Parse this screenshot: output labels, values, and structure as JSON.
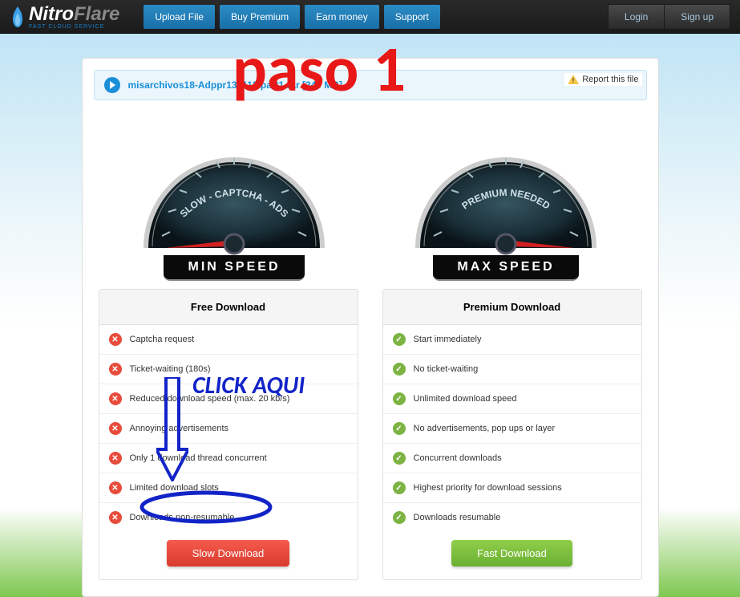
{
  "header": {
    "logo_nitro": "Nitro",
    "logo_flare": "Flare",
    "logo_subtitle": "FAST CLOUD SERVICE",
    "nav": [
      "Upload File",
      "Buy Premium",
      "Earn money",
      "Support"
    ],
    "login": "Login",
    "signup": "Sign up"
  },
  "file": {
    "name": "misarchivos18-Adppr130113.part1.rar [240 MB]"
  },
  "report_link": "Report this file",
  "gauges": {
    "left_arc_text": "SLOW - CAPTCHA - ADS",
    "left_label": "MIN SPEED",
    "right_arc_text": "PREMIUM NEEDED",
    "right_label": "MAX SPEED"
  },
  "columns": {
    "free": {
      "title": "Free Download",
      "items": [
        "Captcha request",
        "Ticket-waiting (180s)",
        "Reduced download speed (max. 20 kb/s)",
        "Annoying advertisements",
        "Only 1 download thread concurrent",
        "Limited download slots",
        "Downloads non-resumable"
      ],
      "button": "Slow Download"
    },
    "premium": {
      "title": "Premium Download",
      "items": [
        "Start immediately",
        "No ticket-waiting",
        "Unlimited download speed",
        "No advertisements, pop ups or layer",
        "Concurrent downloads",
        "Highest priority for download sessions",
        "Downloads resumable"
      ],
      "button": "Fast Download"
    }
  },
  "annotations": {
    "paso": "paso 1",
    "click": "CLICK AQUI"
  }
}
